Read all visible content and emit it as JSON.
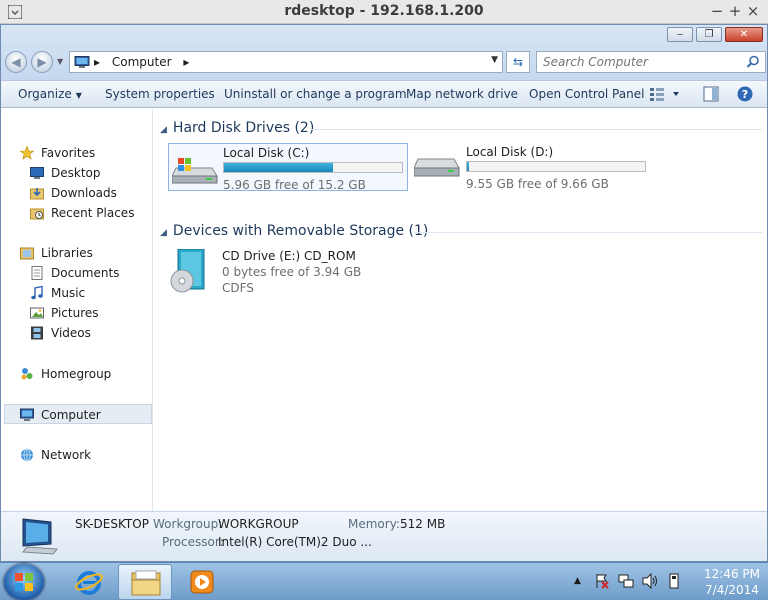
{
  "rdesktop": {
    "title": "rdesktop - 192.168.1.200"
  },
  "window": {
    "controls": {
      "minimize": "‒",
      "restore": "❐",
      "close": "✕"
    }
  },
  "address": {
    "crumbs": [
      "Computer"
    ]
  },
  "search": {
    "placeholder": "Search Computer"
  },
  "toolbar": {
    "organize": "Organize",
    "system_properties": "System properties",
    "uninstall": "Uninstall or change a program",
    "map_drive": "Map network drive",
    "control_panel": "Open Control Panel"
  },
  "sidebar": {
    "favorites": "Favorites",
    "desktop": "Desktop",
    "downloads": "Downloads",
    "recent_places": "Recent Places",
    "libraries": "Libraries",
    "documents": "Documents",
    "music": "Music",
    "pictures": "Pictures",
    "videos": "Videos",
    "homegroup": "Homegroup",
    "computer": "Computer",
    "network": "Network"
  },
  "groups": {
    "hdd": "Hard Disk Drives (2)",
    "removable": "Devices with Removable Storage (1)"
  },
  "drives": [
    {
      "name": "Local Disk (C:)",
      "info": "5.96 GB free of 15.2 GB",
      "used_fraction": 0.61
    },
    {
      "name": "Local Disk (D:)",
      "info": "9.55 GB free of 9.66 GB",
      "used_fraction": 0.011
    }
  ],
  "cd": {
    "name": "CD Drive (E:) CD_ROM",
    "info": "0 bytes free of 3.94 GB",
    "fs": "CDFS"
  },
  "details": {
    "computer_name": "SK-DESKTOP",
    "workgroup_label": "Workgroup:",
    "workgroup": "WORKGROUP",
    "memory_label": "Memory:",
    "memory": "512 MB",
    "processor_label": "Processor:",
    "processor": "Intel(R) Core(TM)2 Duo ..."
  },
  "taskbar": {
    "time": "12:46 PM",
    "date": "7/4/2014"
  }
}
